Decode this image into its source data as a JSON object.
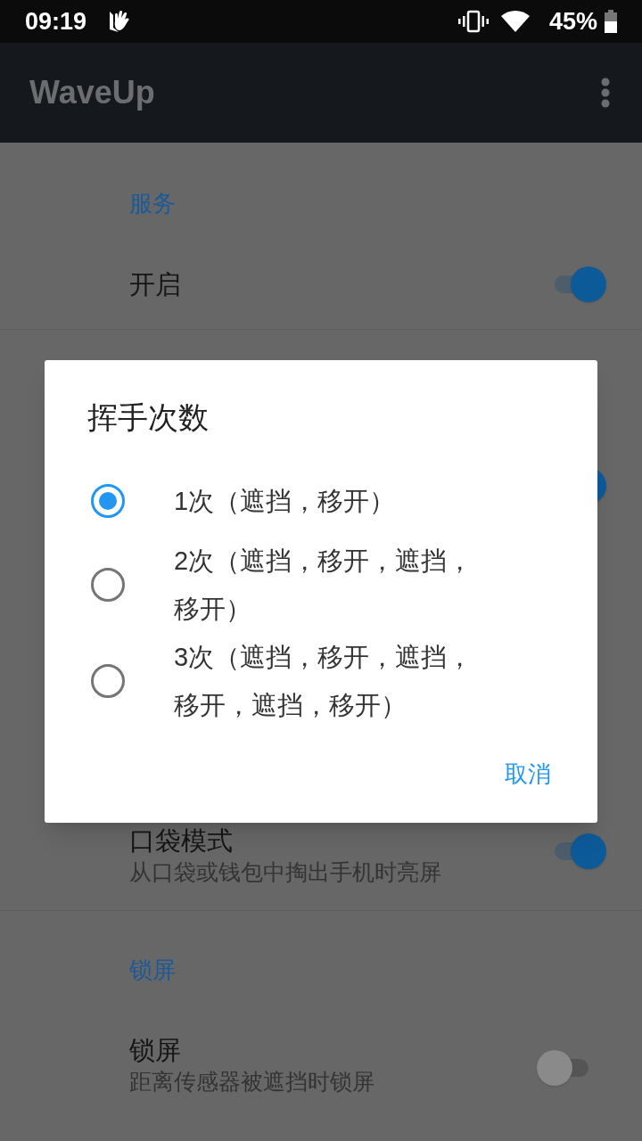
{
  "status_bar": {
    "time": "09:19",
    "battery": "45%"
  },
  "app_bar": {
    "title": "WaveUp"
  },
  "sections": [
    {
      "header": "服务",
      "items": [
        {
          "kind": "switch",
          "title": "开启",
          "on": true
        },
        {
          "kind": "switch",
          "on": true
        }
      ]
    },
    {
      "items": [
        {
          "kind": "switch",
          "title": "口袋模式",
          "subtitle": "从口袋或钱包中掏出手机时亮屏",
          "on": true
        }
      ]
    },
    {
      "header": "锁屏",
      "items": [
        {
          "kind": "switch",
          "title": "锁屏",
          "subtitle": "距离传感器被遮挡时锁屏",
          "on": false
        }
      ]
    }
  ],
  "dialog": {
    "title": "挥手次数",
    "options": [
      {
        "label": "1次（遮挡，移开）",
        "selected": true
      },
      {
        "label": "2次（遮挡，移开，遮挡，移开）",
        "selected": false
      },
      {
        "label": "3次（遮挡，移开，遮挡，移开，遮挡，移开）",
        "selected": false
      }
    ],
    "buttons": [
      "取消"
    ]
  }
}
